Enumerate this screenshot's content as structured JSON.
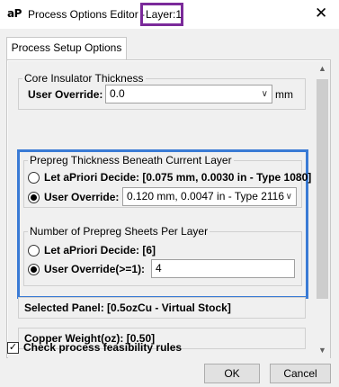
{
  "window": {
    "logo_text": "aP",
    "title": "Process Options Editor -",
    "layer_label": "Layer:1",
    "close_glyph": "✕"
  },
  "tabs": [
    {
      "label": "Process Setup Options"
    }
  ],
  "core_insulator": {
    "legend": "Core Insulator Thickness",
    "override_label": "User Override:",
    "value": "0.0",
    "unit": "mm"
  },
  "prepreg_thickness": {
    "legend": "Prepreg Thickness Beneath Current Layer",
    "apriori_label": "Let aPriori Decide: [0.075 mm, 0.0030 in - Type 1080]",
    "override_label": "User Override:",
    "override_value": "0.120 mm, 0.0047 in - Type 2116",
    "selected": "override"
  },
  "prepreg_sheets": {
    "legend": "Number of Prepreg Sheets Per Layer",
    "apriori_label": "Let aPriori Decide: [6]",
    "override_label": "User Override(>=1):",
    "override_value": "4",
    "selected": "override"
  },
  "selected_panel": "Selected Panel: [0.5ozCu - Virtual Stock]",
  "copper_weight": "Copper Weight(oz): [0.50]",
  "feasibility": {
    "label": "Check process feasibility rules",
    "checked": true
  },
  "buttons": {
    "ok": "OK",
    "cancel": "Cancel"
  },
  "colors": {
    "highlight_border": "#3a7bd5",
    "layer_box_border": "#7b2a9a"
  }
}
